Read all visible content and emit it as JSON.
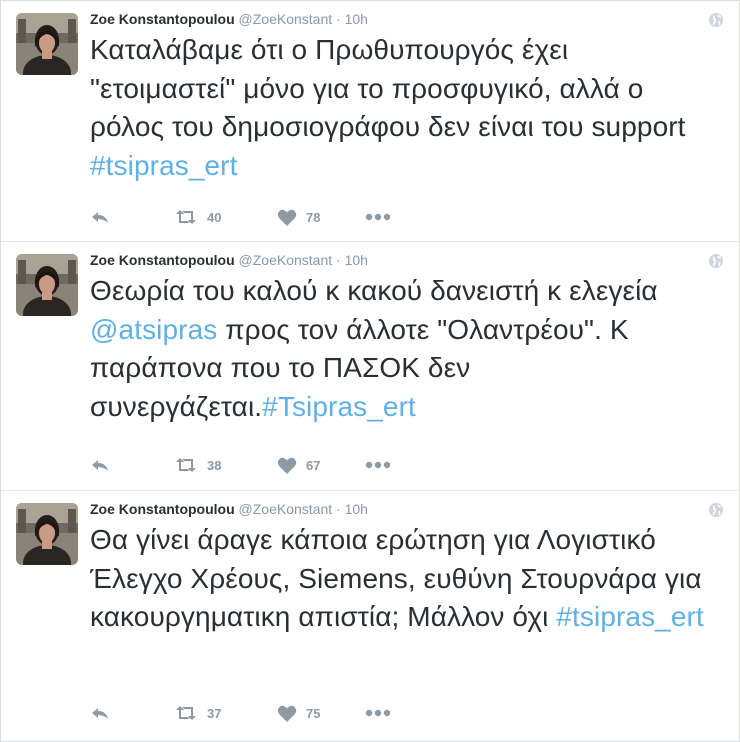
{
  "tweets": [
    {
      "name": "Zoe Konstantopoulou",
      "handle": "@ZoeKonstant",
      "separator": "·",
      "time": "10h",
      "text_before": "Καταλάβαμε ότι ο Πρωθυπουργός έχει \"ετοιμαστεί\" μόνο για το προσφυγικό, αλλά ο ρόλος του δημοσιογράφου δεν είναι του support ",
      "mention": "",
      "text_middle": "",
      "hashtag": "#tsipras_ert",
      "retweets": "40",
      "likes": "78"
    },
    {
      "name": "Zoe Konstantopoulou",
      "handle": "@ZoeKonstant",
      "separator": "·",
      "time": "10h",
      "text_before": "Θεωρία του καλού κ κακού δανειστή κ ελεγεία ",
      "mention": "@atsipras",
      "text_middle": " προς τον άλλοτε \"Ολαντρέου\". Κ παράπονα που το ΠΑΣΟΚ δεν συνεργάζεται.",
      "hashtag": "#Tsipras_ert",
      "retweets": "38",
      "likes": "67"
    },
    {
      "name": "Zoe Konstantopoulou",
      "handle": "@ZoeKonstant",
      "separator": "·",
      "time": "10h",
      "text_before": "Θα γίνει άραγε κάποια ερώτηση για Λογιστικό Έλεγχο Χρέους, Siemens, ευθύνη Στουρνάρα για κακουργηματικη απιστία; Μάλλον όχι ",
      "mention": "",
      "text_middle": "",
      "hashtag": "#tsipras_ert",
      "retweets": "37",
      "likes": "75"
    }
  ],
  "icons": {
    "reply": "reply-icon",
    "retweet": "retweet-icon",
    "like": "heart-icon",
    "more": "more-icon",
    "visibility": "globe-icon"
  },
  "colors": {
    "name": "#292f33",
    "meta": "#8899a6",
    "text": "#292f33",
    "hashtag": "#5fb0e6",
    "action": "#8e9ba5"
  }
}
